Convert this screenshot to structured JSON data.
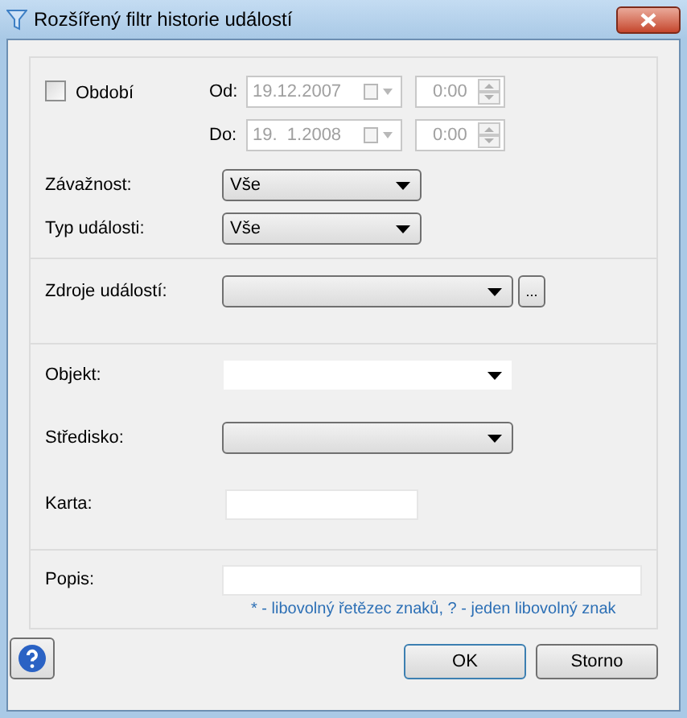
{
  "window": {
    "title": "Rozšířený filtr historie událostí"
  },
  "period": {
    "label": "Období",
    "checked": false,
    "disabled": true,
    "from": {
      "label": "Od:",
      "date": "19.12.2007",
      "time": "0:00"
    },
    "to": {
      "label": "Do:",
      "date": "19.  1.2008",
      "time": "0:00"
    }
  },
  "severity": {
    "label": "Závažnost:",
    "value": "Vše"
  },
  "event_type": {
    "label": "Typ události:",
    "value": "Vše"
  },
  "sources": {
    "label": "Zdroje událostí:",
    "browse": "..."
  },
  "object": {
    "label": "Objekt:",
    "kind": "editable"
  },
  "center": {
    "label": "Středisko:",
    "kind": "list"
  },
  "card": {
    "label": "Karta:"
  },
  "description": {
    "label": "Popis:",
    "hint": "* - libovolný řetězec znaků, ? - jeden libovolný znak"
  },
  "buttons": [
    {
      "label": "OK",
      "kind": "default"
    },
    {
      "label": "Storno",
      "kind": "normal"
    }
  ]
}
